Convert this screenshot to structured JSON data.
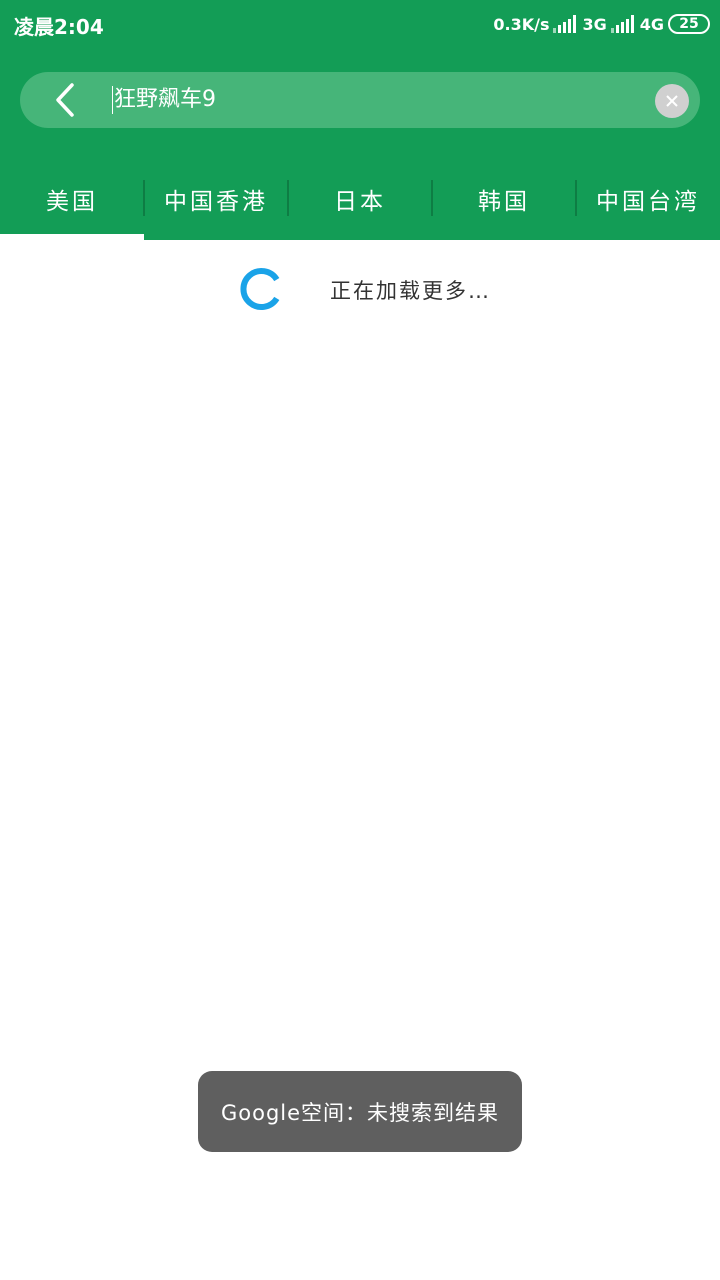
{
  "status_bar": {
    "time": "凌晨2:04",
    "net_speed": "0.3K/s",
    "signal1_label": "3G",
    "signal2_label": "4G",
    "battery": "25"
  },
  "search": {
    "query": "狂野飙车9",
    "back_icon": "chevron-left-icon",
    "clear_icon": "close-icon"
  },
  "tabs": [
    {
      "label": "美国",
      "selected": true
    },
    {
      "label": "中国香港",
      "selected": false
    },
    {
      "label": "日本",
      "selected": false
    },
    {
      "label": "韩国",
      "selected": false
    },
    {
      "label": "中国台湾",
      "selected": false
    }
  ],
  "loading": {
    "text": "正在加载更多…"
  },
  "toast": {
    "text": "Google空间：未搜索到结果"
  },
  "colors": {
    "primary": "#139d56",
    "search_bg": "#46b579",
    "spinner": "#1aa3e8",
    "toast_bg": "#5f5f5f"
  }
}
